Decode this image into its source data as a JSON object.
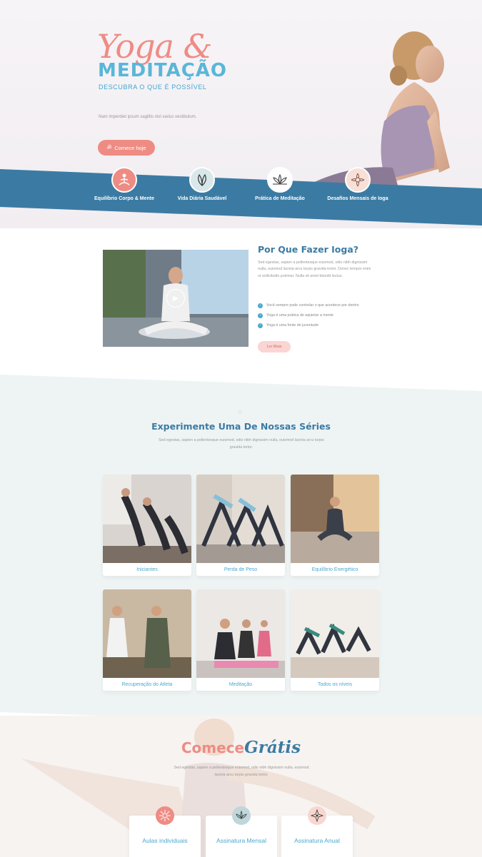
{
  "hero": {
    "title_script": "Yoga &",
    "title_main": "MEDITAÇÃO",
    "subtitle": "DESCUBRA O QUE É POSSÍVEL",
    "text": "Nam imperdiet ipsum sagittis nisl varius vestibulum.",
    "button_label": "Comece hoje",
    "button_icon": "om-icon"
  },
  "features": [
    {
      "label": "Equilíbrio Corpo & Mente",
      "icon": "meditating-figure-icon"
    },
    {
      "label": "Vida Diária Saudável",
      "icon": "leaf-icon"
    },
    {
      "label": "Prática de Meditação",
      "icon": "lotus-icon"
    },
    {
      "label": "Desafios Mensais de Ioga",
      "icon": "mandala-icon"
    }
  ],
  "why": {
    "title": "Por Que Fazer Ioga?",
    "text": "Sed egestas, sapien a pellentesque euismod, odio nibh dignissim nulla, euismod lacinia arcu turpis gravida tortor. Donec tempor enim ut sollicitudin pulvinar. Nulla sit amet blandit lectus.",
    "list": [
      "Você sempre pode controlar o que acontece por dentro",
      "Yoga é uma prática de aquietar a mente",
      "Yoga é uma fonte de juventude"
    ],
    "button_label": "Ler Mais",
    "video_icon": "play-icon"
  },
  "series": {
    "title": "Experimente Uma De Nossas Séries",
    "text": "Sed egestas, sapien a pellentesque euismod, odio nibh dignissim nulla, euismod lacinia arcu turpis gravida tortor.",
    "cards": [
      {
        "label": "Iniciantes"
      },
      {
        "label": "Perda de Peso"
      },
      {
        "label": "Equilíbrio Energético"
      },
      {
        "label": "Recuperação do Atleta"
      },
      {
        "label": "Meditação"
      },
      {
        "label": "Todos os níveis"
      }
    ]
  },
  "gratis": {
    "title_main": "Comece",
    "title_script": "Grátis",
    "text": "Sed egestas, sapien a pellentesque euismod, odio nibh dignissim nulla, euismod lacinia arcu turpis gravida tortor.",
    "plans": [
      {
        "label": "Aulas individuais",
        "color": "#ee8c84",
        "icon": "mandala-icon"
      },
      {
        "label": "Assinatura Mensal",
        "color": "#bfd6da",
        "icon": "lotus-icon"
      },
      {
        "label": "Assinatura Anual",
        "color": "#f7d7cf",
        "icon": "star-flower-icon"
      }
    ]
  },
  "colors": {
    "coral": "#ee8c84",
    "blue_band": "#3b7ba3",
    "light_blue": "#4aa8d0",
    "series_bg": "#eef4f4"
  }
}
